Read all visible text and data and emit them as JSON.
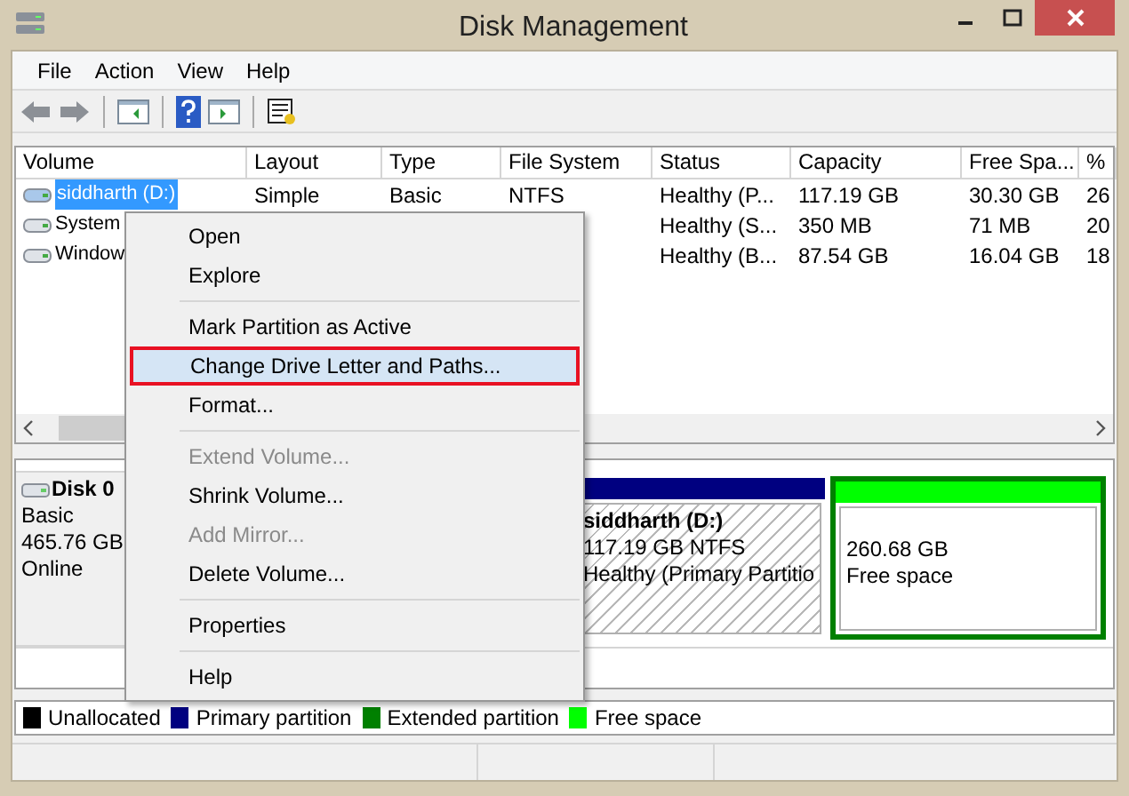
{
  "window": {
    "title": "Disk Management"
  },
  "menu_bar": [
    "File",
    "Action",
    "View",
    "Help"
  ],
  "table": {
    "columns": [
      "Volume",
      "Layout",
      "Type",
      "File System",
      "Status",
      "Capacity",
      "Free Spa...",
      "%"
    ],
    "rows": [
      {
        "selected": true,
        "cells": [
          "siddharth (D:)",
          "Simple",
          "Basic",
          "NTFS",
          "Healthy (P...",
          "117.19 GB",
          "30.30 GB",
          "26"
        ]
      },
      {
        "selected": false,
        "cells": [
          "System",
          "",
          "",
          "",
          "Healthy (S...",
          "350 MB",
          "71 MB",
          "20"
        ]
      },
      {
        "selected": false,
        "cells": [
          "Window",
          "",
          "",
          "",
          "Healthy (B...",
          "87.54 GB",
          "16.04 GB",
          "18"
        ]
      }
    ]
  },
  "disk": {
    "name": "Disk 0",
    "type": "Basic",
    "size": "465.76 GB",
    "state": "Online",
    "partitions": [
      {
        "kind": "primary",
        "label": "siddharth  (D:)",
        "size": "117.19 GB NTFS",
        "status": "Healthy (Primary Partitio"
      },
      {
        "kind": "free",
        "size": "260.68 GB",
        "status": "Free space"
      }
    ]
  },
  "legend": [
    {
      "label": "Unallocated",
      "color": "#000000"
    },
    {
      "label": "Primary partition",
      "color": "#000080"
    },
    {
      "label": "Extended partition",
      "color": "#008000"
    },
    {
      "label": "Free space",
      "color": "#00ff00"
    }
  ],
  "context_menu": [
    {
      "kind": "item",
      "label": "Open",
      "disabled": false,
      "selected": false
    },
    {
      "kind": "item",
      "label": "Explore",
      "disabled": false,
      "selected": false
    },
    {
      "kind": "separator"
    },
    {
      "kind": "item",
      "label": "Mark Partition as Active",
      "disabled": false,
      "selected": false
    },
    {
      "kind": "item",
      "label": "Change Drive Letter and Paths...",
      "disabled": false,
      "selected": true
    },
    {
      "kind": "item",
      "label": "Format...",
      "disabled": false,
      "selected": false
    },
    {
      "kind": "separator"
    },
    {
      "kind": "item",
      "label": "Extend Volume...",
      "disabled": true,
      "selected": false
    },
    {
      "kind": "item",
      "label": "Shrink Volume...",
      "disabled": false,
      "selected": false
    },
    {
      "kind": "item",
      "label": "Add Mirror...",
      "disabled": true,
      "selected": false
    },
    {
      "kind": "item",
      "label": "Delete Volume...",
      "disabled": false,
      "selected": false
    },
    {
      "kind": "separator"
    },
    {
      "kind": "item",
      "label": "Properties",
      "disabled": false,
      "selected": false
    },
    {
      "kind": "separator"
    },
    {
      "kind": "item",
      "label": "Help",
      "disabled": false,
      "selected": false
    }
  ]
}
